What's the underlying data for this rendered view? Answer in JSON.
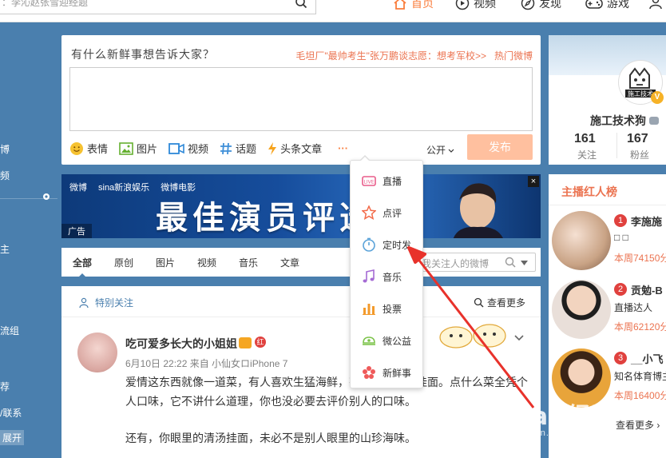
{
  "topbar": {
    "search_placeholder": "：李沁赵张雪迎经题",
    "nav": [
      {
        "label": "首页",
        "icon": "home-icon"
      },
      {
        "label": "视频",
        "icon": "video-icon"
      },
      {
        "label": "发现",
        "icon": "compass-icon"
      },
      {
        "label": "游戏",
        "icon": "gamepad-icon"
      }
    ],
    "accent": "#fa7d3c"
  },
  "leftnav": {
    "items": [
      "博",
      "频",
      "主",
      "流组",
      "荐",
      "/联系"
    ],
    "open_label": "展开"
  },
  "publish": {
    "prompt": "有什么新鲜事想告诉大家？",
    "hot_topic": "毛坦厂\"最帅考生\"张万鹏谈志愿：想考军校>>",
    "hot_link": "热门微博",
    "tools": [
      {
        "label": "表情",
        "icon": "smile-icon"
      },
      {
        "label": "图片",
        "icon": "picture-icon"
      },
      {
        "label": "视频",
        "icon": "video-camera-icon"
      },
      {
        "label": "话题",
        "icon": "hashtag-icon"
      },
      {
        "label": "头条文章",
        "icon": "lightning-icon"
      }
    ],
    "more_label": "···",
    "visibility": "公开",
    "send_label": "发布",
    "send_color": "#ffc09f"
  },
  "banner": {
    "logos": [
      "微博",
      "sina新浪娱乐",
      "微博电影"
    ],
    "title": "最佳演员评选",
    "ad_label": "广告",
    "close_label": "×"
  },
  "tabs": {
    "items": [
      "全部",
      "原创",
      "图片",
      "视频",
      "音乐",
      "文章"
    ],
    "active": "全部",
    "search_placeholder": "我关注人的微博"
  },
  "feed": {
    "special_label": "特别关注",
    "more_label": "查看更多",
    "post": {
      "username": "吃可爱多长大的小姐姐",
      "badge": "红",
      "meta": "6月10日 22:22 来自 小仙女ロiPhone 7",
      "paragraphs": [
        "爱情这东西就像一道菜，有人喜欢生猛海鲜，有人偏爱清汤挂面。点什么菜全凭个人口味，它不讲什么道理，你也没必要去评价别人的口味。",
        "还有，你眼里的清汤挂面，未必不是别人眼里的山珍海味。"
      ]
    }
  },
  "profile": {
    "name": "施工技术狗",
    "avatar_caption": "施工技术",
    "follow_count": "161",
    "follow_label": "关注",
    "fans_count": "167",
    "fans_label": "粉丝"
  },
  "ranking": {
    "title": "主播红人榜",
    "items": [
      {
        "rank": "1",
        "name": "李施施",
        "desc": "□ □",
        "week": "本周74150分"
      },
      {
        "rank": "2",
        "name": "贡勉-B",
        "desc": "直播达人",
        "week": "本周62120分"
      },
      {
        "rank": "3",
        "name": "__小飞",
        "desc": "知名体育博主",
        "week": "本周16400分"
      }
    ],
    "see_more": "查看更多 ›"
  },
  "dropdown": {
    "items": [
      {
        "label": "直播",
        "icon": "live-icon",
        "color": "#e95c8a"
      },
      {
        "label": "点评",
        "icon": "star-icon",
        "color": "#f36b4a"
      },
      {
        "label": "定时发",
        "icon": "stopwatch-icon",
        "color": "#5ba3d9"
      },
      {
        "label": "音乐",
        "icon": "music-icon",
        "color": "#a56bd4"
      },
      {
        "label": "投票",
        "icon": "bar-chart-icon",
        "color": "#f39a2b"
      },
      {
        "label": "微公益",
        "icon": "charity-icon",
        "color": "#7cc34a"
      },
      {
        "label": "新鲜事",
        "icon": "flower-icon",
        "color": "#ef5a5a"
      }
    ]
  },
  "watermark": {
    "big": "Bai 经验",
    "small": "jingyan.baidu.com"
  }
}
